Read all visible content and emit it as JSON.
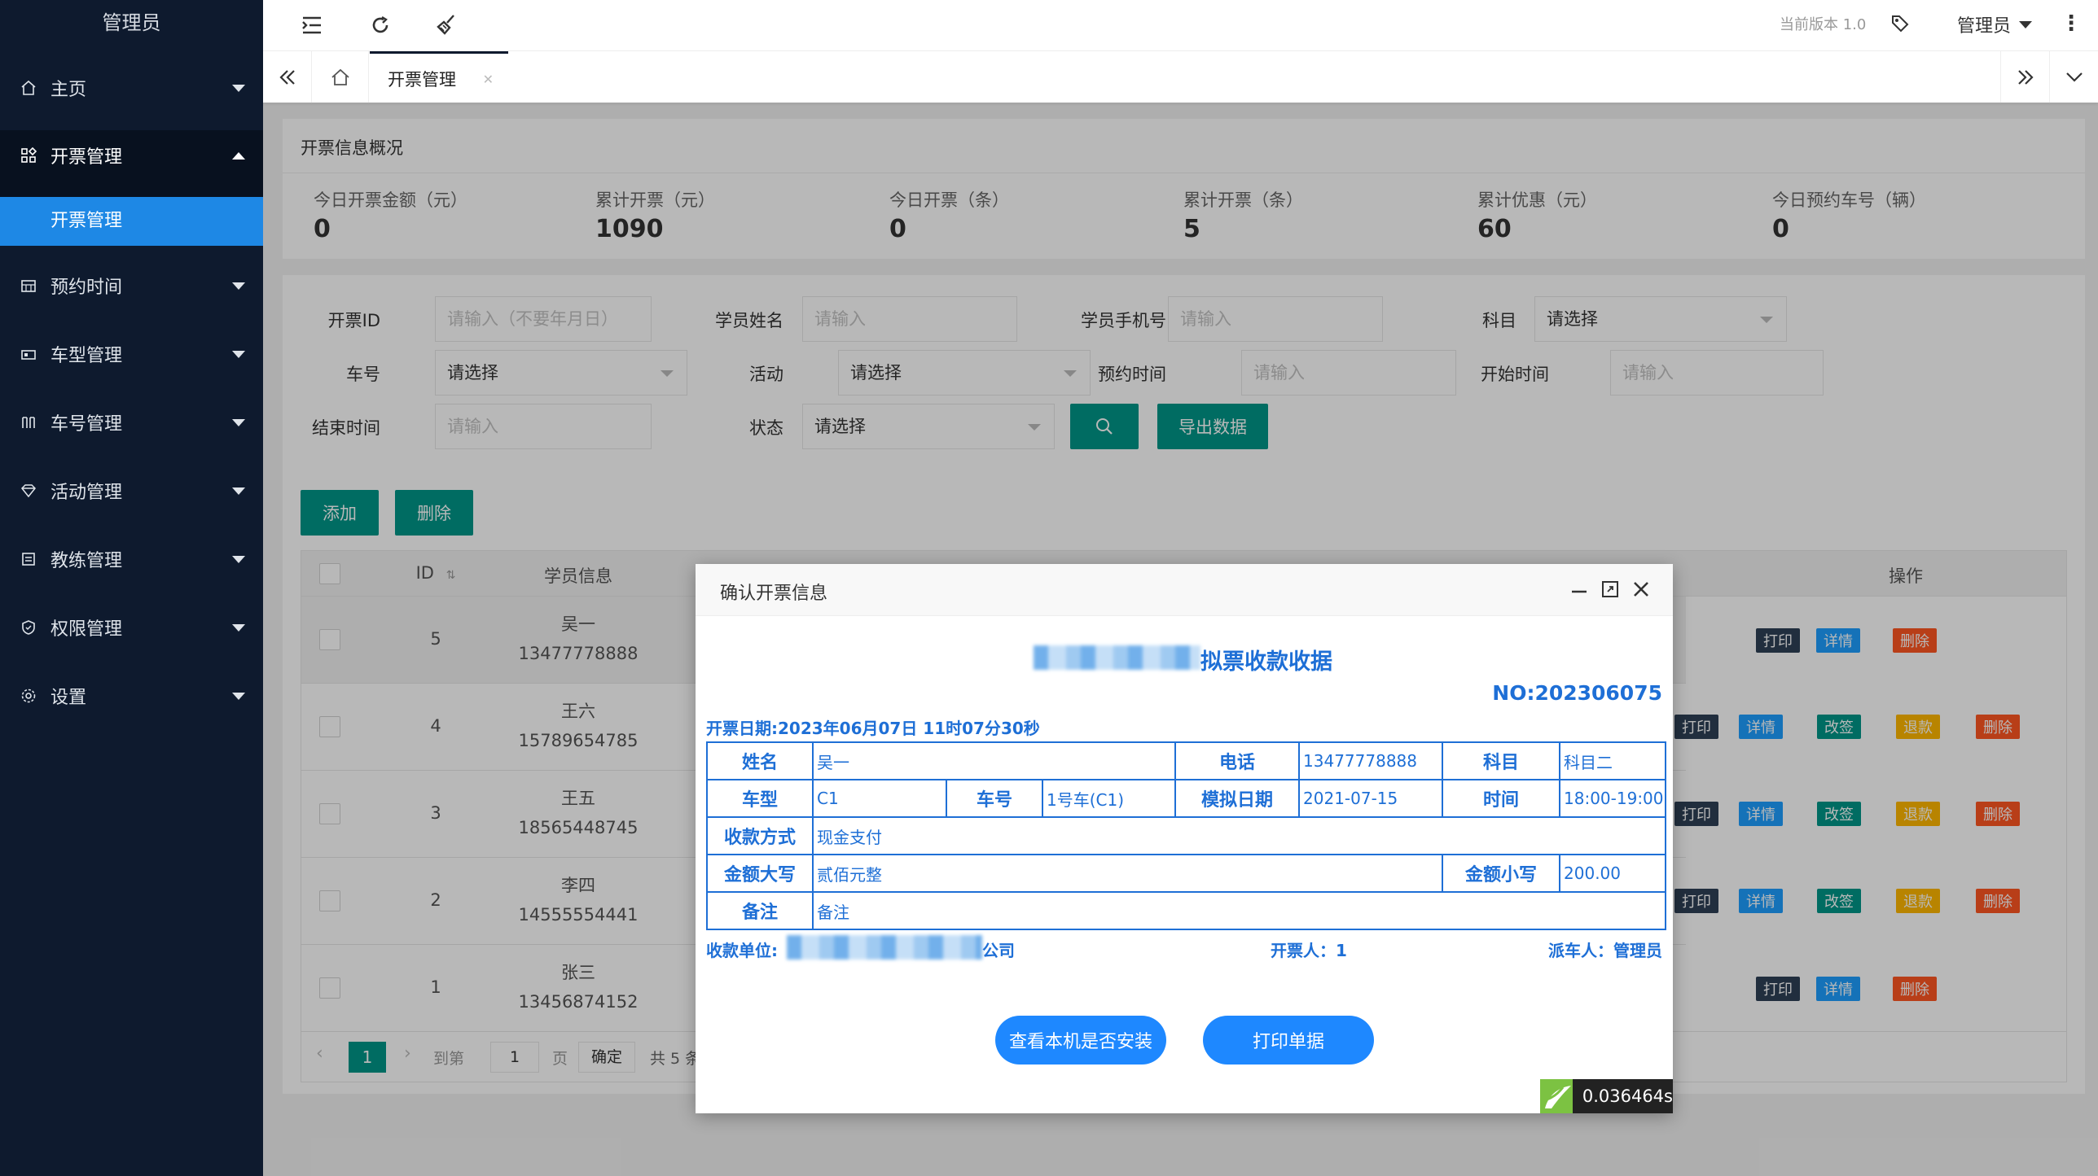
{
  "sidebar": {
    "brand": "管理员",
    "items": [
      {
        "label": "主页",
        "icon": "home-icon"
      },
      {
        "label": "开票管理",
        "icon": "grid-icon"
      },
      {
        "label": "预约时间",
        "icon": "calendar-icon"
      },
      {
        "label": "车型管理",
        "icon": "car-type-icon"
      },
      {
        "label": "车号管理",
        "icon": "car-number-icon"
      },
      {
        "label": "活动管理",
        "icon": "diamond-icon"
      },
      {
        "label": "教练管理",
        "icon": "coach-icon"
      },
      {
        "label": "权限管理",
        "icon": "shield-icon"
      },
      {
        "label": "设置",
        "icon": "gear-icon"
      }
    ],
    "sub_item": "开票管理"
  },
  "header": {
    "version": "当前版本 1.0",
    "user": "管理员"
  },
  "tabs": {
    "active": "开票管理"
  },
  "overview": {
    "title": "开票信息概况",
    "stats": [
      {
        "label": "今日开票金额（元）",
        "value": "0"
      },
      {
        "label": "累计开票（元）",
        "value": "1090"
      },
      {
        "label": "今日开票（条）",
        "value": "0"
      },
      {
        "label": "累计开票（条）",
        "value": "5"
      },
      {
        "label": "累计优惠（元）",
        "value": "60"
      },
      {
        "label": "今日预约车号（辆）",
        "value": "0"
      }
    ]
  },
  "filters": {
    "invoice_id_label": "开票ID",
    "invoice_id_placeholder": "请输入（不要年月日）",
    "student_name_label": "学员姓名",
    "student_name_placeholder": "请输入",
    "student_phone_label": "学员手机号",
    "student_phone_placeholder": "请输入",
    "subject_label": "科目",
    "subject_value": "请选择",
    "car_label": "车号",
    "car_value": "请选择",
    "activity_label": "活动",
    "activity_value": "请选择",
    "booking_label": "预约时间",
    "booking_placeholder": "请输入",
    "start_label": "开始时间",
    "start_placeholder": "请输入",
    "end_label": "结束时间",
    "end_placeholder": "请输入",
    "status_label": "状态",
    "status_value": "请选择",
    "export_label": "导出数据"
  },
  "actions": {
    "add": "添加",
    "delete": "删除"
  },
  "table": {
    "headers": {
      "id": "ID",
      "student": "学员信息",
      "ops": "操作"
    },
    "rows": [
      {
        "id": "5",
        "name": "吴一",
        "phone": "13477778888"
      },
      {
        "id": "4",
        "name": "王六",
        "phone": "15789654785"
      },
      {
        "id": "3",
        "name": "王五",
        "phone": "18565448745"
      },
      {
        "id": "2",
        "name": "李四",
        "phone": "14555554441"
      },
      {
        "id": "1",
        "name": "张三",
        "phone": "13456874152"
      }
    ],
    "ops": {
      "print": "打印",
      "detail": "详情",
      "change": "改签",
      "refund": "退款",
      "delete": "删除"
    }
  },
  "pagination": {
    "current": "1",
    "goto_label": "到第",
    "goto_value": "1",
    "page_unit": "页",
    "confirm": "确定",
    "total": "共 5 条"
  },
  "modal": {
    "title": "确认开票信息",
    "receipt_title": "拟票收款收据",
    "receipt_no": "NO:202306075",
    "date_line": "开票日期:2023年06月07日 11时07分30秒",
    "fields": {
      "name_label": "姓名",
      "name": "吴一",
      "phone_label": "电话",
      "phone": "13477778888",
      "subject_label": "科目",
      "subject": "科目二",
      "car_type_label": "车型",
      "car_type": "C1",
      "car_no_label": "车号",
      "car_no": "1号车(C1)",
      "sim_date_label": "模拟日期",
      "sim_date": "2021-07-15",
      "time_label": "时间",
      "time": "18:00-19:00",
      "pay_label": "收款方式",
      "pay": "现金支付",
      "amount_upper_label": "金额大写",
      "amount_upper": "贰佰元整",
      "amount_lower_label": "金额小写",
      "amount_lower": "200.00",
      "remark_label": "备注",
      "remark": "备注"
    },
    "payee_label": "收款单位:",
    "payee_suffix": "公司",
    "issuer": "开票人：1",
    "dispatcher": "派车人：管理员",
    "check_btn": "查看本机是否安装",
    "print_btn": "打印单据"
  },
  "timer": "0.036464s"
}
